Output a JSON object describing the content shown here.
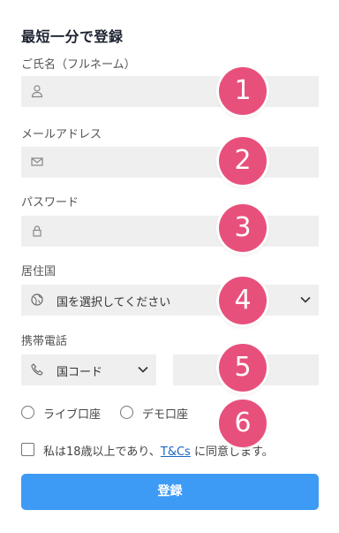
{
  "form": {
    "title": "最短一分で登録",
    "name_label": "ご氏名（フルネーム）",
    "email_label": "メールアドレス",
    "password_label": "パスワード",
    "country_label": "居住国",
    "country_select": "国を選択してください",
    "phone_label": "携帯電話",
    "country_code_select": "国コード",
    "account_types": [
      "ライブ口座",
      "デモ口座"
    ],
    "agree_prefix": "私は18歳以上であり、",
    "agree_link": "T&Cs",
    "agree_suffix": "に同意します。",
    "submit_label": "登録"
  },
  "badges": [
    "1",
    "2",
    "3",
    "4",
    "5",
    "6"
  ],
  "colors": {
    "badge": "#e8507c",
    "submit": "#3d9bf5",
    "field_bg": "#efefef",
    "link": "#1a66c2"
  },
  "icons": [
    "user-icon",
    "mail-icon",
    "lock-icon",
    "globe-icon",
    "phone-icon",
    "chevron-down-icon"
  ]
}
